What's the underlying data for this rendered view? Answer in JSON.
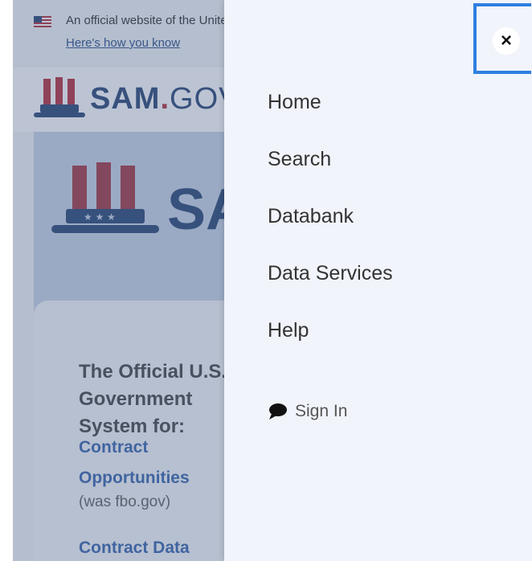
{
  "gov_banner": {
    "text": "An official website of the United States government",
    "link": "Here's how you know"
  },
  "logo": {
    "sam": "SAM",
    "dot": ".",
    "gov": "GOV"
  },
  "hero": {
    "title": "The Official U.S. Government System for:",
    "link1": "Contract Opportunities",
    "note": "(was fbo.gov)",
    "link2": "Contract Data"
  },
  "menu": {
    "close_label": "×",
    "items": [
      "Home",
      "Search",
      "Databank",
      "Data Services",
      "Help"
    ],
    "sign_in": "Sign In"
  },
  "colors": {
    "brand_navy": "#1a3a6b",
    "brand_red": "#b21f2d",
    "focus_blue": "#2f7fe0",
    "link_blue": "#2a5aa8"
  }
}
